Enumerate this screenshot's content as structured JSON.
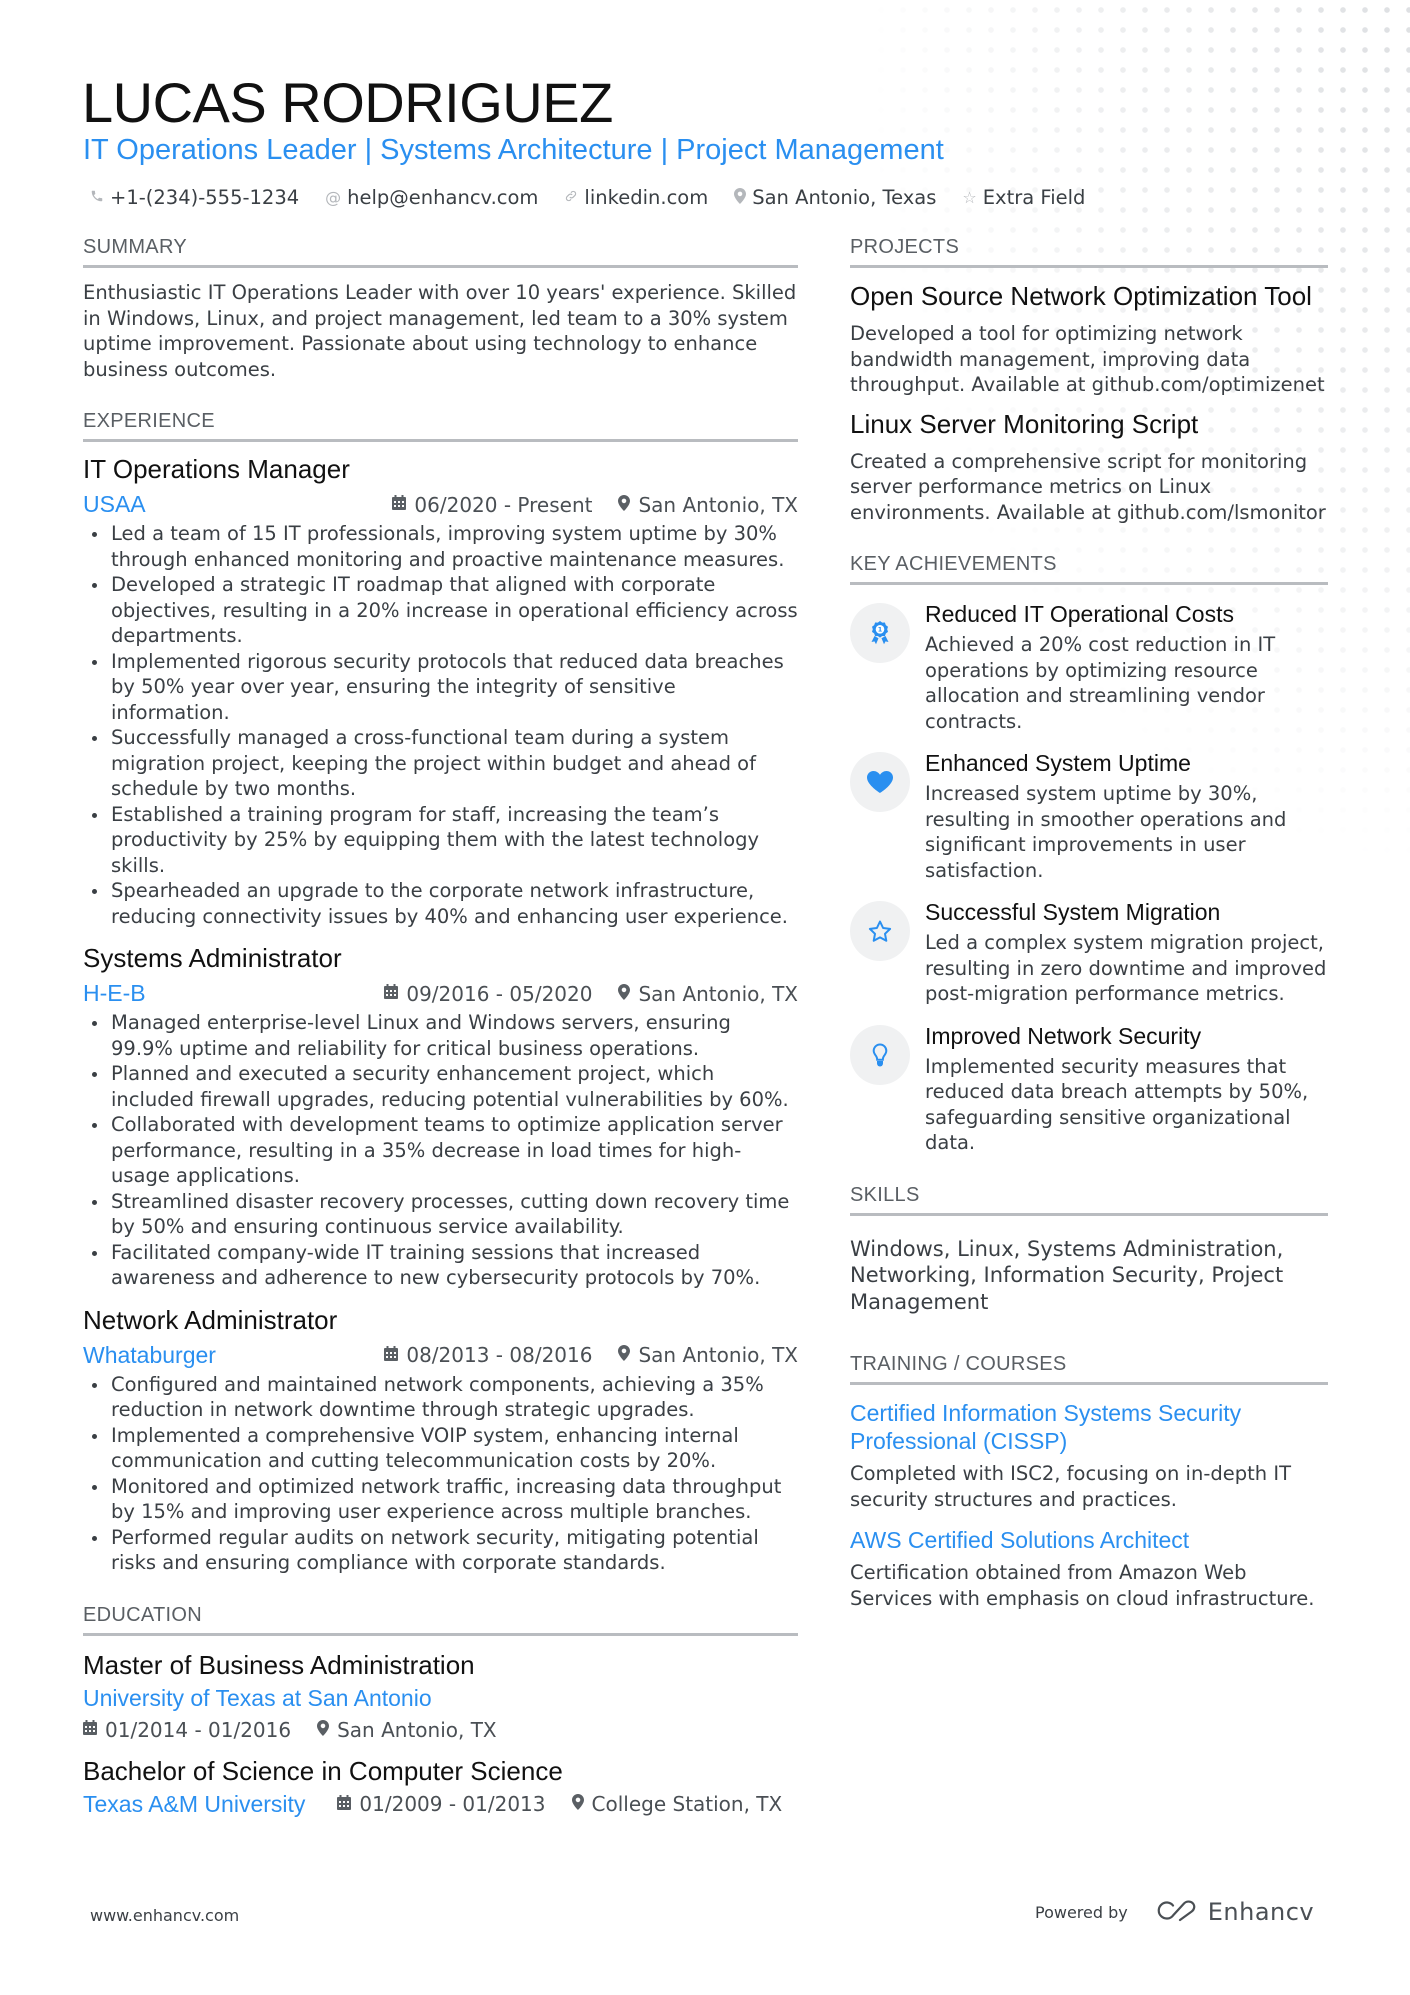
{
  "header": {
    "name": "LUCAS RODRIGUEZ",
    "title": "IT Operations Leader | Systems Architecture | Project Management",
    "contacts": [
      {
        "icon": "phone-icon",
        "text": "+1-(234)-555-1234"
      },
      {
        "icon": "at-icon",
        "text": "help@enhancv.com"
      },
      {
        "icon": "link-icon",
        "text": "linkedin.com"
      },
      {
        "icon": "location-pin-icon",
        "text": "San Antonio, Texas"
      },
      {
        "icon": "star-icon",
        "text": "Extra Field"
      }
    ]
  },
  "summary": {
    "heading": "SUMMARY",
    "text": "Enthusiastic IT Operations Leader with over 10 years' experience. Skilled in Windows, Linux, and project management, led team to a 30% system uptime improvement. Passionate about using technology to enhance business outcomes."
  },
  "experience": {
    "heading": "EXPERIENCE",
    "jobs": [
      {
        "title": "IT Operations Manager",
        "company": "USAA",
        "dates": "06/2020 - Present",
        "location": "San Antonio, TX",
        "bullets": [
          "Led a team of 15 IT professionals, improving system uptime by 30% through enhanced monitoring and proactive maintenance measures.",
          "Developed a strategic IT roadmap that aligned with corporate objectives, resulting in a 20% increase in operational efficiency across departments.",
          "Implemented rigorous security protocols that reduced data breaches by 50% year over year, ensuring the integrity of sensitive information.",
          "Successfully managed a cross-functional team during a system migration project, keeping the project within budget and ahead of schedule by two months.",
          "Established a training program for staff, increasing the team’s productivity by 25% by equipping them with the latest technology skills.",
          "Spearheaded an upgrade to the corporate network infrastructure, reducing connectivity issues by 40% and enhancing user experience."
        ]
      },
      {
        "title": "Systems Administrator",
        "company": "H-E-B",
        "dates": "09/2016 - 05/2020",
        "location": "San Antonio, TX",
        "bullets": [
          "Managed enterprise-level Linux and Windows servers, ensuring 99.9% uptime and reliability for critical business operations.",
          "Planned and executed a security enhancement project, which included firewall upgrades, reducing potential vulnerabilities by 60%.",
          "Collaborated with development teams to optimize application server performance, resulting in a 35% decrease in load times for high-usage applications.",
          "Streamlined disaster recovery processes, cutting down recovery time by 50% and ensuring continuous service availability.",
          "Facilitated company-wide IT training sessions that increased awareness and adherence to new cybersecurity protocols by 70%."
        ]
      },
      {
        "title": "Network Administrator",
        "company": "Whataburger",
        "dates": "08/2013 - 08/2016",
        "location": "San Antonio, TX",
        "bullets": [
          "Configured and maintained network components, achieving a 35% reduction in network downtime through strategic upgrades.",
          "Implemented a comprehensive VOIP system, enhancing internal communication and cutting telecommunication costs by 20%.",
          "Monitored and optimized network traffic, increasing data throughput by 15% and improving user experience across multiple branches.",
          "Performed regular audits on network security, mitigating potential risks and ensuring compliance with corporate standards."
        ]
      }
    ]
  },
  "education": {
    "heading": "EDUCATION",
    "items": [
      {
        "degree": "Master of Business Administration",
        "school": "University of Texas at San Antonio",
        "dates": "01/2014 - 01/2016",
        "location": "San Antonio, TX"
      },
      {
        "degree": "Bachelor of Science in Computer Science",
        "school": "Texas A&M University",
        "dates": "01/2009 - 01/2013",
        "location": "College Station, TX"
      }
    ]
  },
  "projects": {
    "heading": "PROJECTS",
    "items": [
      {
        "title": "Open Source Network Optimization Tool",
        "desc": "Developed a tool for optimizing network bandwidth management, improving data throughput. Available at github.com/optimizenet"
      },
      {
        "title": "Linux Server Monitoring Script",
        "desc": "Created a comprehensive script for monitoring server performance metrics on Linux environments. Available at github.com/lsmonitor"
      }
    ]
  },
  "achievements": {
    "heading": "KEY ACHIEVEMENTS",
    "items": [
      {
        "icon": "award-ribbon-icon",
        "title": "Reduced IT Operational Costs",
        "desc": "Achieved a 20% cost reduction in IT operations by optimizing resource allocation and streamlining vendor contracts."
      },
      {
        "icon": "heart-icon",
        "title": "Enhanced System Uptime",
        "desc": "Increased system uptime by 30%, resulting in smoother operations and significant improvements in user satisfaction."
      },
      {
        "icon": "star-icon",
        "title": "Successful System Migration",
        "desc": "Led a complex system migration project, resulting in zero downtime and improved post-migration performance metrics."
      },
      {
        "icon": "lightbulb-icon",
        "title": "Improved Network Security",
        "desc": "Implemented security measures that reduced data breach attempts by 50%, safeguarding sensitive organizational data."
      }
    ]
  },
  "skills": {
    "heading": "SKILLS",
    "text": "Windows, Linux, Systems Administration, Networking, Information Security, Project Management"
  },
  "training": {
    "heading": "TRAINING / COURSES",
    "items": [
      {
        "title": "Certified Information Systems Security Professional (CISSP)",
        "desc": "Completed with ISC2, focusing on in-depth IT security structures and practices."
      },
      {
        "title": "AWS Certified Solutions Architect",
        "desc": "Certification obtained from Amazon Web Services with emphasis on cloud infrastructure."
      }
    ]
  },
  "footer": {
    "website": "www.enhancv.com",
    "powered_by": "Powered by",
    "brand": "Enhancv"
  },
  "colors": {
    "accent": "#2a8ff0",
    "text": "#3a3f44",
    "heading_rule": "#b9bcc0",
    "icon_bg": "#f0f1f2"
  }
}
